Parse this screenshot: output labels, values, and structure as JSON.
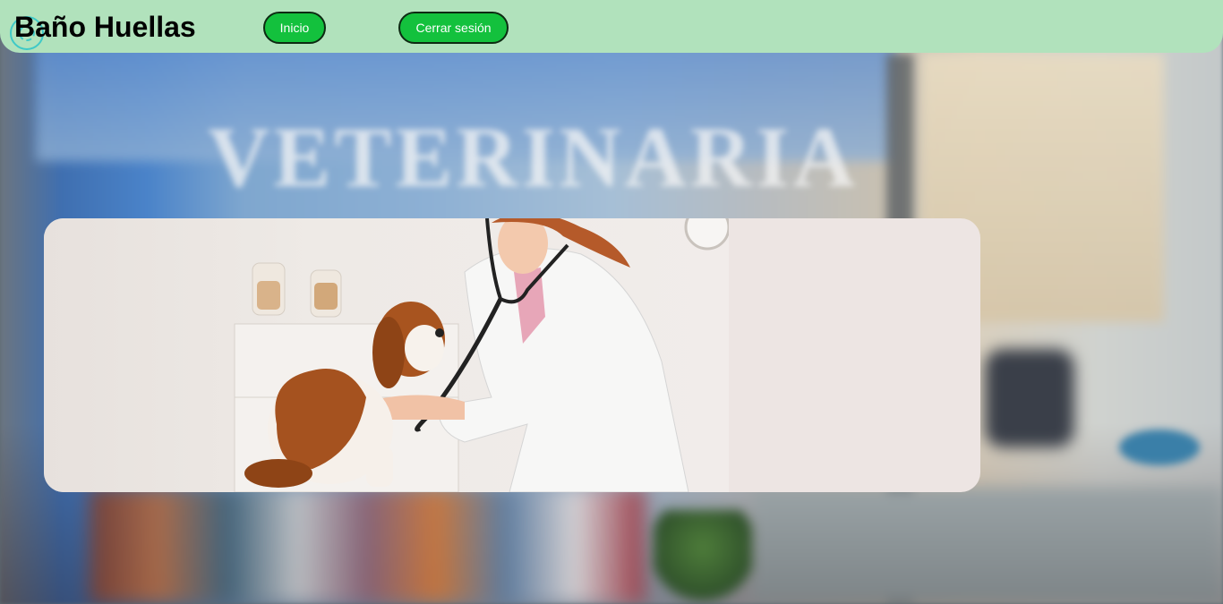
{
  "header": {
    "title": "Baño Huellas",
    "logo_icon": "paw-circle-icon",
    "nav": {
      "inicio_label": "Inicio",
      "logout_label": "Cerrar sesión"
    },
    "colors": {
      "bar": "#b1e2bc",
      "button": "#13c13d"
    }
  },
  "background": {
    "sign_text": "VETERINARIA"
  },
  "hero": {
    "image": "veterinarian-examining-dog-photo"
  }
}
